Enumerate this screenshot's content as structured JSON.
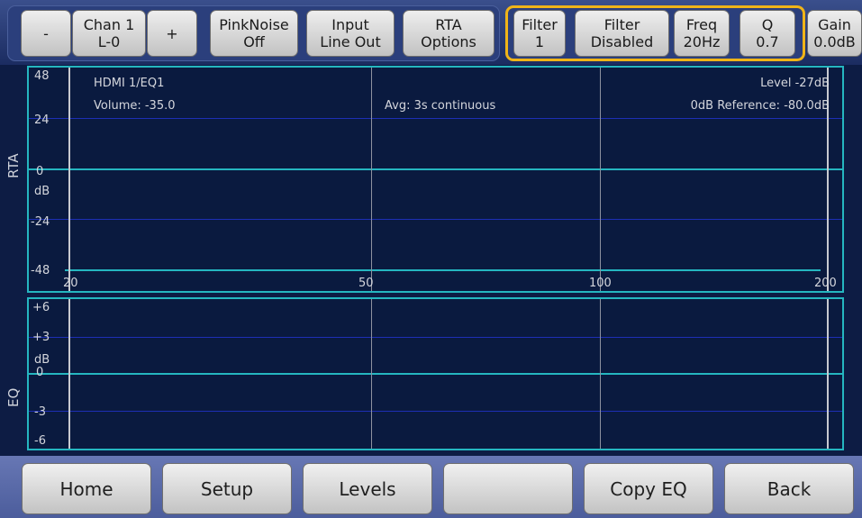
{
  "toolbar": {
    "minus": "-",
    "chan": [
      "Chan 1",
      "L-0"
    ],
    "plus": "+",
    "pinknoise": [
      "PinkNoise",
      "Off"
    ],
    "input": [
      "Input",
      "Line Out"
    ],
    "rta_options": [
      "RTA",
      "Options"
    ],
    "filter": [
      "Filter",
      "1"
    ],
    "filter_state": [
      "Filter",
      "Disabled"
    ],
    "freq": [
      "Freq",
      "20Hz"
    ],
    "q": [
      "Q",
      "0.7"
    ],
    "gain": [
      "Gain",
      "0.0dB"
    ],
    "highlight_color": "#f0b418"
  },
  "rta": {
    "title": "RTA",
    "source": "HDMI 1/EQ1",
    "volume": "Volume: -35.0",
    "avg": "Avg: 3s continuous",
    "level": "Level -27dB",
    "reference": "0dB Reference: -80.0dB",
    "y_ticks": [
      "48",
      "24",
      "0",
      "dB",
      "-24",
      "-48"
    ],
    "x_ticks": [
      "20",
      "50",
      "100",
      "200"
    ]
  },
  "eq": {
    "title": "EQ",
    "y_ticks": [
      "+6",
      "+3",
      "dB",
      "0",
      "-3",
      "-6"
    ]
  },
  "bottom": {
    "home": "Home",
    "setup": "Setup",
    "levels": "Levels",
    "blank": "",
    "copy_eq": "Copy EQ",
    "back": "Back"
  },
  "colors": {
    "grid_line": "#1d2fb4",
    "zero_line": "#25b6c0",
    "background": "#0a1a3f"
  }
}
